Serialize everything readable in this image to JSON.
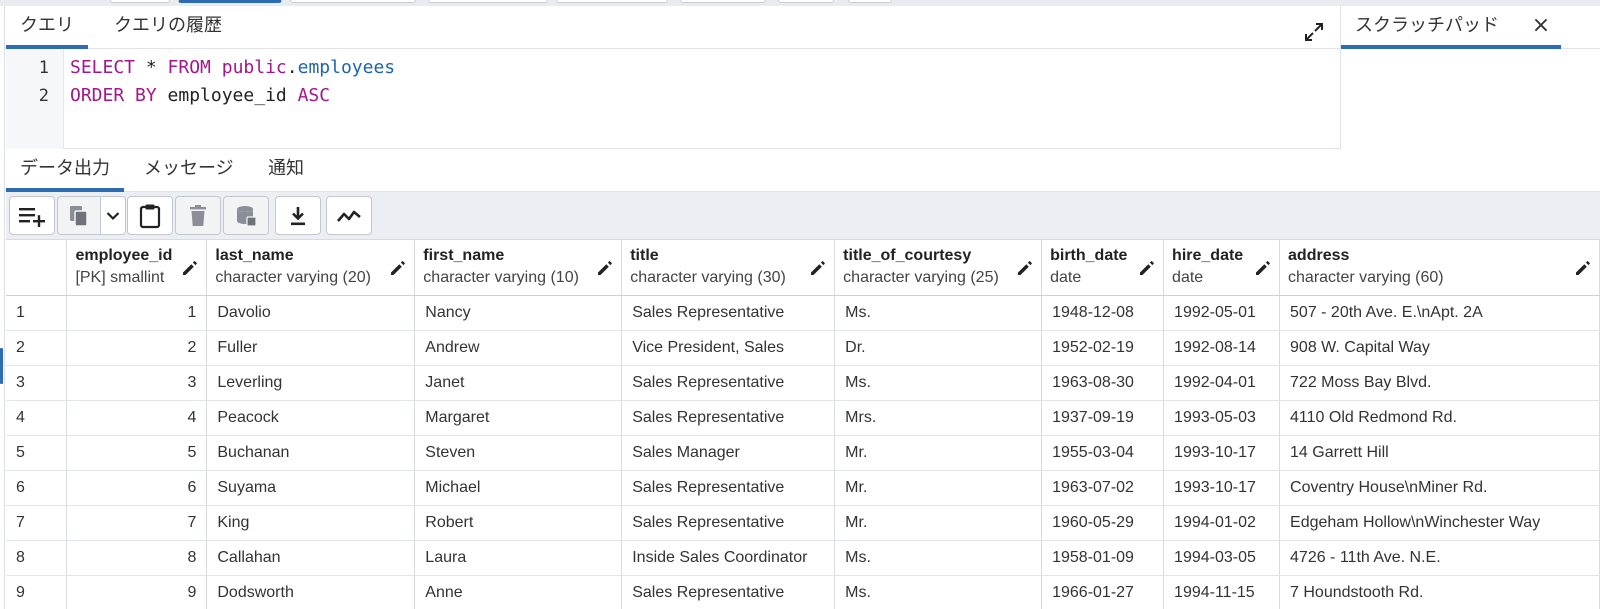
{
  "query_tabs": [
    {
      "label": "クエリ",
      "active": true
    },
    {
      "label": "クエリの履歴",
      "active": false
    }
  ],
  "scratchpad": {
    "label": "スクラッチパッド",
    "close": "×"
  },
  "editor": {
    "line_numbers": [
      "1",
      "2"
    ],
    "line1": {
      "kw1": "SELECT",
      "star": " * ",
      "kw2": "FROM",
      "schema": " public",
      "dot": ".",
      "table": "employees"
    },
    "line2": {
      "kw1": "ORDER BY",
      "col": " employee_id ",
      "kw2": "ASC"
    }
  },
  "result_tabs": [
    {
      "label": "データ出力",
      "active": true
    },
    {
      "label": "メッセージ",
      "active": false
    },
    {
      "label": "通知",
      "active": false
    }
  ],
  "toolbar_icons": [
    "add-row-icon",
    "copy-icon",
    "chevron-down-icon",
    "paste-icon",
    "delete-icon",
    "save-data-icon",
    "download-icon",
    "graph-icon"
  ],
  "columns": [
    {
      "name": "employee_id",
      "type": "[PK] smallint"
    },
    {
      "name": "last_name",
      "type": "character varying (20)"
    },
    {
      "name": "first_name",
      "type": "character varying (10)"
    },
    {
      "name": "title",
      "type": "character varying (30)"
    },
    {
      "name": "title_of_courtesy",
      "type": "character varying (25)"
    },
    {
      "name": "birth_date",
      "type": "date"
    },
    {
      "name": "hire_date",
      "type": "date"
    },
    {
      "name": "address",
      "type": "character varying (60)"
    }
  ],
  "rows": [
    [
      "1",
      "1",
      "Davolio",
      "Nancy",
      "Sales Representative",
      "Ms.",
      "1948-12-08",
      "1992-05-01",
      "507 - 20th Ave. E.\\nApt. 2A"
    ],
    [
      "2",
      "2",
      "Fuller",
      "Andrew",
      "Vice President, Sales",
      "Dr.",
      "1952-02-19",
      "1992-08-14",
      "908 W. Capital Way"
    ],
    [
      "3",
      "3",
      "Leverling",
      "Janet",
      "Sales Representative",
      "Ms.",
      "1963-08-30",
      "1992-04-01",
      "722 Moss Bay Blvd."
    ],
    [
      "4",
      "4",
      "Peacock",
      "Margaret",
      "Sales Representative",
      "Mrs.",
      "1937-09-19",
      "1993-05-03",
      "4110 Old Redmond Rd."
    ],
    [
      "5",
      "5",
      "Buchanan",
      "Steven",
      "Sales Manager",
      "Mr.",
      "1955-03-04",
      "1993-10-17",
      "14 Garrett Hill"
    ],
    [
      "6",
      "6",
      "Suyama",
      "Michael",
      "Sales Representative",
      "Mr.",
      "1963-07-02",
      "1993-10-17",
      "Coventry House\\nMiner Rd."
    ],
    [
      "7",
      "7",
      "King",
      "Robert",
      "Sales Representative",
      "Mr.",
      "1960-05-29",
      "1994-01-02",
      "Edgeham Hollow\\nWinchester Way"
    ],
    [
      "8",
      "8",
      "Callahan",
      "Laura",
      "Inside Sales Coordinator",
      "Ms.",
      "1958-01-09",
      "1994-03-05",
      "4726 - 11th Ave. N.E."
    ],
    [
      "9",
      "9",
      "Dodsworth",
      "Anne",
      "Sales Representative",
      "Ms.",
      "1966-01-27",
      "1994-11-15",
      "7 Houndstooth Rd."
    ]
  ],
  "colors": {
    "accent": "#2d6cb0",
    "keyword": "#a3168c",
    "identifier": "#1f64b0"
  }
}
